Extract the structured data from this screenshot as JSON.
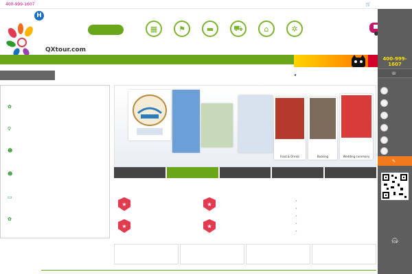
{
  "topbar": {
    "welcome": "",
    "hotline": "400-999-1607",
    "links": [
      "",
      "",
      "",
      ""
    ]
  },
  "logo": {
    "brand_top": "",
    "main_name": "",
    "main_suffix": "",
    "domain": "QXtour.com"
  },
  "city": {
    "button": "",
    "sub": ""
  },
  "nav": [
    {
      "label": "",
      "icon": "calendar-icon"
    },
    {
      "label": "",
      "icon": "flag-icon"
    },
    {
      "label": "",
      "icon": "ticket-icon"
    },
    {
      "label": "",
      "icon": "car-icon"
    },
    {
      "label": "",
      "icon": "hotel-icon"
    },
    {
      "label": "",
      "icon": "compass-icon"
    }
  ],
  "greenbar": {
    "items": [
      "",
      "",
      "",
      "",
      ""
    ],
    "badges": [
      "",
      "",
      ""
    ],
    "banner_text": ""
  },
  "category": {
    "title": ""
  },
  "announce": "",
  "left_groups": [
    {
      "title": "",
      "icon": "leaf-icon",
      "links": [
        "",
        "",
        "",
        "",
        ""
      ]
    },
    {
      "title": "",
      "icon": "pin-icon",
      "links": [
        "",
        "",
        "",
        ""
      ]
    },
    {
      "title": "",
      "icon": "person-icon",
      "links": [
        "",
        "",
        "",
        ""
      ]
    },
    {
      "title": "",
      "icon": "person-icon",
      "links": [
        "",
        ""
      ]
    },
    {
      "title": "",
      "icon": "bus-icon",
      "links": [
        "",
        "",
        ""
      ]
    },
    {
      "title": "",
      "icon": "leaf-icon",
      "links": [
        "",
        "",
        "",
        ""
      ]
    }
  ],
  "slider_captions": [
    "",
    "Food & Drinks",
    "Booking",
    "Wedding ceremony"
  ],
  "tabs": [
    "",
    "",
    "",
    "",
    ""
  ],
  "active_tab": 1,
  "features": [
    {
      "title": "",
      "desc": ""
    },
    {
      "title": "",
      "desc": ""
    },
    {
      "title": "",
      "desc": ""
    },
    {
      "title": "",
      "desc": ""
    }
  ],
  "news": [
    "",
    "",
    "",
    "",
    ""
  ],
  "footer_title": "",
  "sidebar": {
    "hotline_title": "",
    "hotline_number": "400-999-1607",
    "online_head": "",
    "qq": [
      "",
      "",
      "",
      "",
      "",
      ""
    ],
    "quick_order": "",
    "scan_line1": "",
    "scan_line2": "",
    "top": "TOP"
  },
  "colors": {
    "brand_green": "#6aa61a",
    "hotline_pink": "#d60a8a",
    "feature_red": "#e23a4f",
    "sidebar_gray": "#5e5e5e",
    "quick_orange": "#f07a1d"
  }
}
